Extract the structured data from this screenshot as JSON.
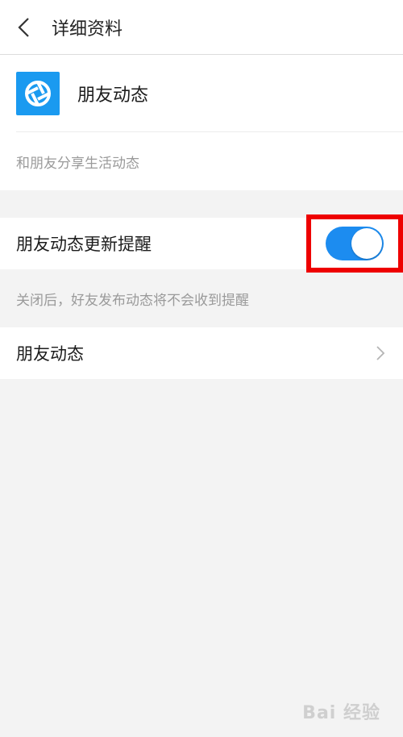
{
  "header": {
    "title": "详细资料"
  },
  "profile": {
    "app_name": "朋友动态",
    "description": "和朋友分享生活动态"
  },
  "update_setting": {
    "label": "朋友动态更新提醒",
    "toggle_on": true,
    "hint": "关闭后，好友发布动态将不会收到提醒"
  },
  "nav_item": {
    "label": "朋友动态"
  },
  "watermark": "Bai 经验",
  "colors": {
    "accent": "#1c8cf0",
    "logo_bg": "#1a9af0",
    "highlight": "#ee0000",
    "page_bg": "#f3f3f3"
  }
}
